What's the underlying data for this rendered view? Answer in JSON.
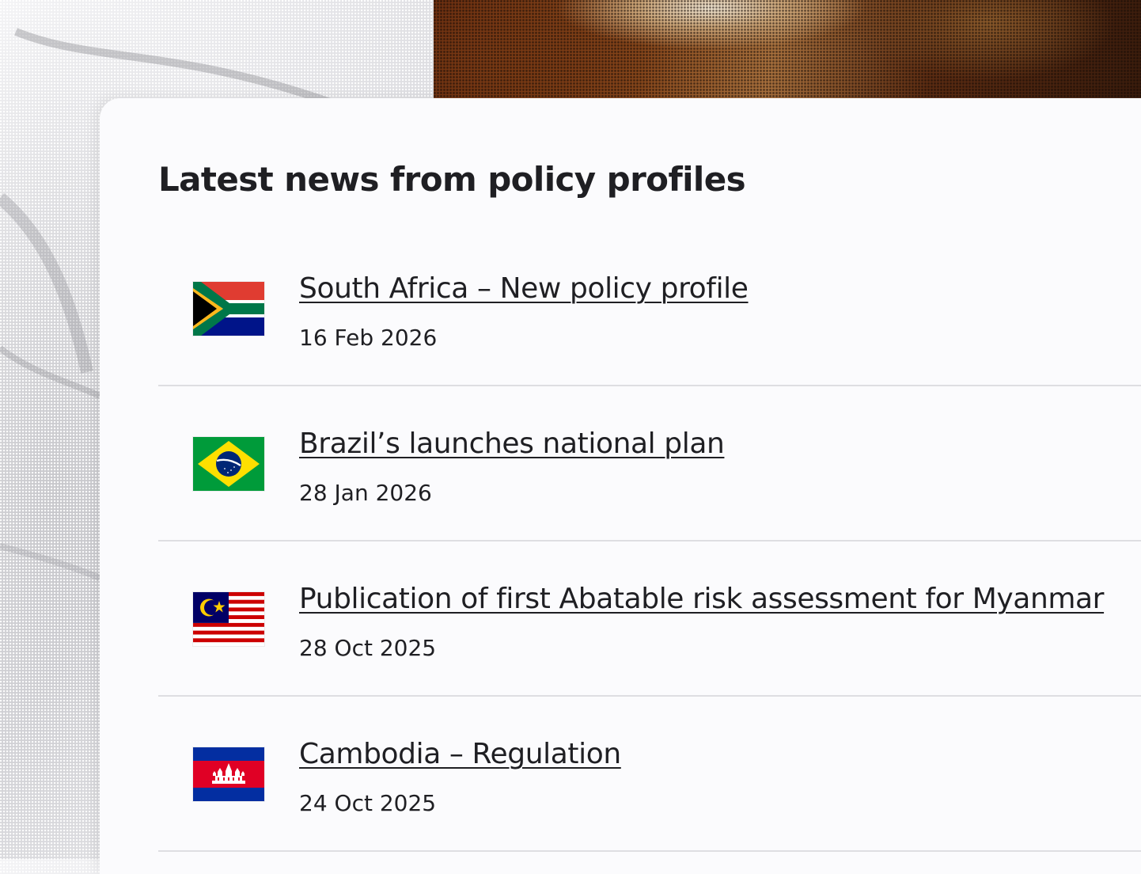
{
  "section": {
    "title": "Latest news from policy profiles"
  },
  "news": [
    {
      "title": "South Africa  – New policy profile",
      "date": "16 Feb 2026",
      "flag_icon": "south-africa-flag-icon"
    },
    {
      "title": "Brazil’s launches national plan",
      "date": "28 Jan 2026",
      "flag_icon": "brazil-flag-icon"
    },
    {
      "title": "Publication of first Abatable risk assessment for Myanmar",
      "date": "28 Oct 2025",
      "flag_icon": "malaysia-flag-icon"
    },
    {
      "title": "Cambodia – Regulation",
      "date": "24 Oct 2025",
      "flag_icon": "cambodia-flag-icon"
    }
  ],
  "colors": {
    "text": "#1f1f23",
    "card": "#fbfbfd",
    "divider": "#dedee2"
  }
}
